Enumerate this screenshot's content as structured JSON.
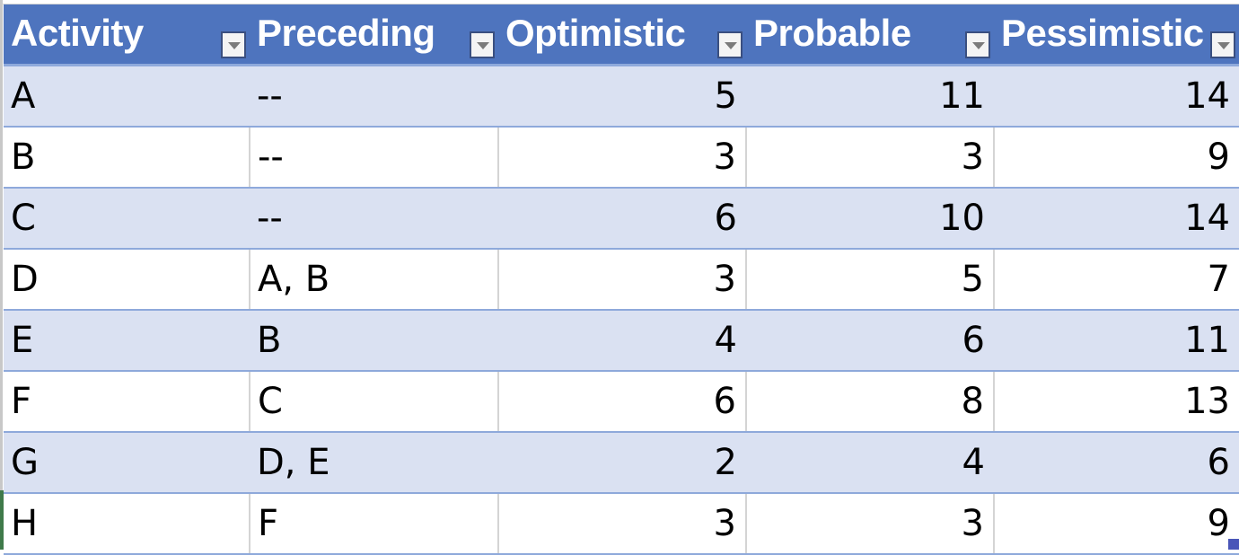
{
  "table": {
    "columns": [
      {
        "label": "Activity",
        "align": "left"
      },
      {
        "label": "Preceding",
        "align": "left"
      },
      {
        "label": "Optimistic",
        "align": "right"
      },
      {
        "label": "Probable",
        "align": "right"
      },
      {
        "label": "Pessimistic",
        "align": "right"
      }
    ],
    "filter_icon": "dropdown-arrow-icon",
    "rows": [
      {
        "activity": "A",
        "preceding": "--",
        "optimistic": "5",
        "probable": "11",
        "pessimistic": "14"
      },
      {
        "activity": "B",
        "preceding": "--",
        "optimistic": "3",
        "probable": "3",
        "pessimistic": "9"
      },
      {
        "activity": "C",
        "preceding": "--",
        "optimistic": "6",
        "probable": "10",
        "pessimistic": "14"
      },
      {
        "activity": "D",
        "preceding": "A, B",
        "optimistic": "3",
        "probable": "5",
        "pessimistic": "7"
      },
      {
        "activity": "E",
        "preceding": "B",
        "optimistic": "4",
        "probable": "6",
        "pessimistic": "11"
      },
      {
        "activity": "F",
        "preceding": "C",
        "optimistic": "6",
        "probable": "8",
        "pessimistic": "13"
      },
      {
        "activity": "G",
        "preceding": "D, E",
        "optimistic": "2",
        "probable": "4",
        "pessimistic": "6"
      },
      {
        "activity": "H",
        "preceding": "F",
        "optimistic": "3",
        "probable": "3",
        "pessimistic": "9"
      }
    ]
  },
  "colors": {
    "header_bg": "#4e74be",
    "band_bg": "#dae1f2",
    "border": "#8ea9db"
  }
}
